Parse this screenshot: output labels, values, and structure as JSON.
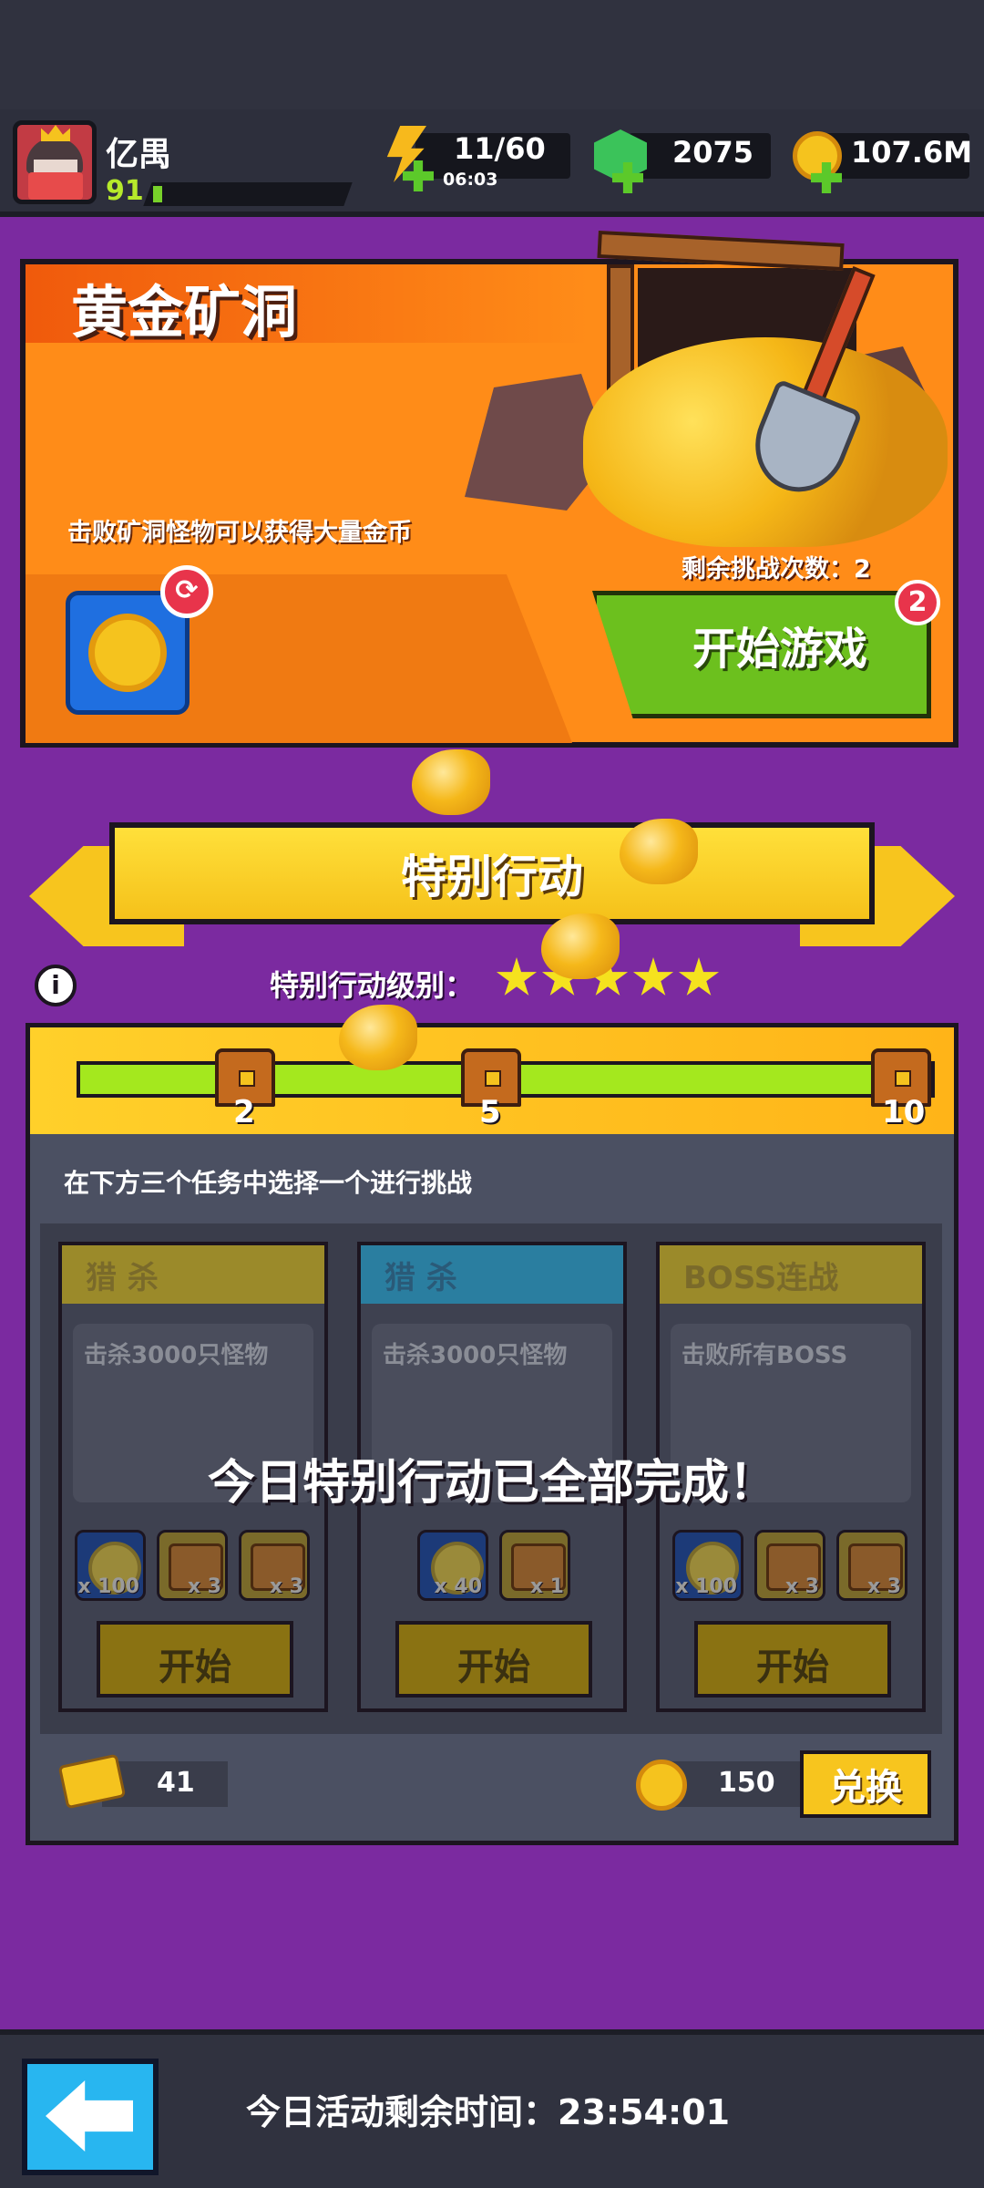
{
  "player": {
    "name": "亿禺",
    "level": "91",
    "xp_fraction": 0.03
  },
  "resources": {
    "energy": "11/60",
    "energy_timer": "06:03",
    "gems": "2075",
    "coins": "107.6M"
  },
  "mine": {
    "title": "黄金矿洞",
    "description": "击败矿洞怪物可以获得大量金币",
    "remaining_label": "剩余挑战次数：2",
    "start_label": "开始游戏",
    "badge": "2",
    "refresh_icon": "refresh-icon"
  },
  "special": {
    "banner_title": "特别行动",
    "level_label": "特别行动级别：",
    "stars": 5,
    "milestones": [
      "2",
      "5",
      "10"
    ],
    "instruction": "在下方三个任务中选择一个进行挑战",
    "complete_message": "今日特别行动已全部完成！"
  },
  "tasks": [
    {
      "title": "猎 杀",
      "header_color": "#9b8a2a",
      "description": "击杀3000只怪物",
      "rewards": [
        {
          "type": "coin",
          "count": "x 100"
        },
        {
          "type": "chest",
          "count": "x 3"
        },
        {
          "type": "chest",
          "count": "x 3"
        }
      ],
      "start_label": "开始"
    },
    {
      "title": "猎 杀",
      "header_color": "#2a7ea0",
      "description": "击杀3000只怪物",
      "rewards": [
        {
          "type": "coin",
          "count": "x 40"
        },
        {
          "type": "chest",
          "count": "x 1"
        }
      ],
      "start_label": "开始"
    },
    {
      "title": "BOSS连战",
      "header_color": "#9b8a2a",
      "description": "击败所有BOSS",
      "rewards": [
        {
          "type": "coin",
          "count": "x 100"
        },
        {
          "type": "chest",
          "count": "x 3"
        },
        {
          "type": "chest",
          "count": "x 3"
        }
      ],
      "start_label": "开始"
    }
  ],
  "footer": {
    "tickets": "41",
    "coins": "150",
    "exchange_label": "兑换"
  },
  "bottom": {
    "time_remaining": "今日活动剩余时间：23:54:01"
  },
  "colors": {
    "background": "#7b2aa0",
    "accent_yellow": "#f7c51e",
    "accent_green": "#6cc01e",
    "badge_red": "#e8344b"
  }
}
